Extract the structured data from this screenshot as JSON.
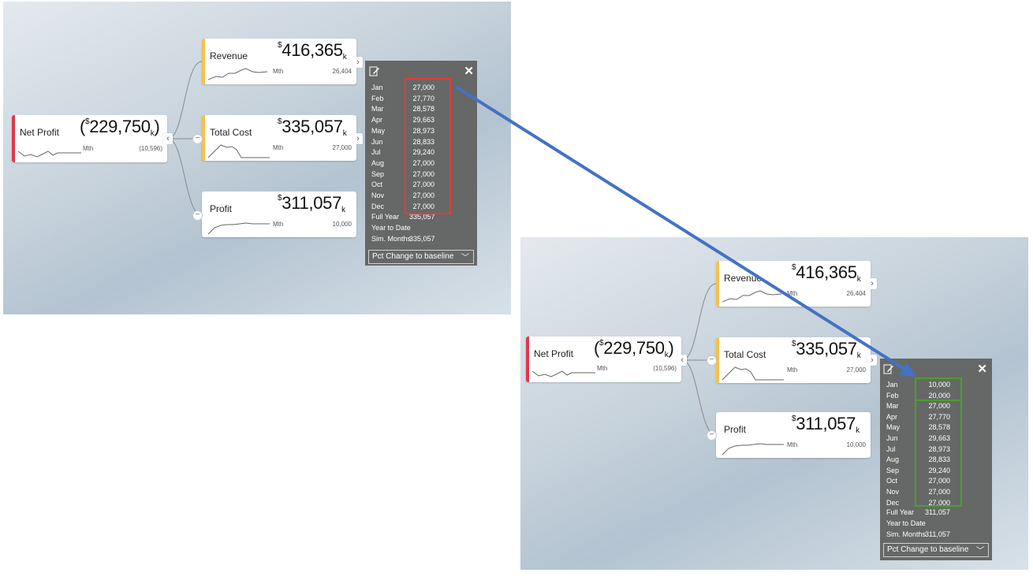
{
  "colors": {
    "arrow": "#4472c4",
    "highlight_before": "#e63a3a",
    "highlight_after": "#4aa02a",
    "net_profit_bar": "#e0384a",
    "kpi_bar": "#f5c14f"
  },
  "before": {
    "net_profit": {
      "title": "Net Profit",
      "open_paren": "(",
      "currency": "$",
      "value": "229,750",
      "unit": "k",
      "close_paren": ")",
      "period": "Mth",
      "delta": "(10,596)"
    },
    "revenue": {
      "title": "Revenue",
      "currency": "$",
      "value": "416,365",
      "unit": "k",
      "period": "Mth",
      "delta": "26,404"
    },
    "total_cost": {
      "title": "Total Cost",
      "currency": "$",
      "value": "335,057",
      "unit": "k",
      "period": "Mth",
      "delta": "27,000"
    },
    "profit": {
      "title": "Profit",
      "currency": "$",
      "value": "311,057",
      "unit": "k",
      "period": "Mth",
      "delta": "10,000"
    },
    "sim": {
      "months": [
        {
          "m": "Jan",
          "v": "27,000"
        },
        {
          "m": "Feb",
          "v": "27,770"
        },
        {
          "m": "Mar",
          "v": "28,578"
        },
        {
          "m": "Apr",
          "v": "29,663"
        },
        {
          "m": "May",
          "v": "28,973"
        },
        {
          "m": "Jun",
          "v": "28,833"
        },
        {
          "m": "Jul",
          "v": "29,240"
        },
        {
          "m": "Aug",
          "v": "27,000"
        },
        {
          "m": "Sep",
          "v": "27,000"
        },
        {
          "m": "Oct",
          "v": "27,000"
        },
        {
          "m": "Nov",
          "v": "27,000"
        },
        {
          "m": "Dec",
          "v": "27,000"
        }
      ],
      "full_year_label": "Full Year",
      "full_year_value": "335,057",
      "ytd_label": "Year to Date",
      "sim_months_label": "Sim. Months",
      "sim_months_value": "335,057",
      "dropdown": "Pct Change to baseline",
      "close": "✕"
    }
  },
  "after": {
    "net_profit": {
      "title": "Net Profit",
      "open_paren": "(",
      "currency": "$",
      "value": "229,750",
      "unit": "k",
      "close_paren": ")",
      "period": "Mth",
      "delta": "(10,596)"
    },
    "revenue": {
      "title": "Revenue",
      "currency": "$",
      "value": "416,365",
      "unit": "k",
      "period": "Mth",
      "delta": "26,404"
    },
    "total_cost": {
      "title": "Total Cost",
      "currency": "$",
      "value": "335,057",
      "unit": "k",
      "period": "Mth",
      "delta": "27,000"
    },
    "profit": {
      "title": "Profit",
      "currency": "$",
      "value": "311,057",
      "unit": "k",
      "period": "Mth",
      "delta": "10,000"
    },
    "sim": {
      "months": [
        {
          "m": "Jan",
          "v": "10,000"
        },
        {
          "m": "Feb",
          "v": "20,000"
        },
        {
          "m": "Mar",
          "v": "27,000"
        },
        {
          "m": "Apr",
          "v": "27,770"
        },
        {
          "m": "May",
          "v": "28,578"
        },
        {
          "m": "Jun",
          "v": "29,663"
        },
        {
          "m": "Jul",
          "v": "28,973"
        },
        {
          "m": "Aug",
          "v": "28,833"
        },
        {
          "m": "Sep",
          "v": "29,240"
        },
        {
          "m": "Oct",
          "v": "27,000"
        },
        {
          "m": "Nov",
          "v": "27,000"
        },
        {
          "m": "Dec",
          "v": "27,000"
        }
      ],
      "full_year_label": "Full Year",
      "full_year_value": "311,057",
      "ytd_label": "Year to Date",
      "sim_months_label": "Sim. Months",
      "sim_months_value": "311,057",
      "dropdown": "Pct Change to baseline",
      "close": "✕"
    }
  }
}
